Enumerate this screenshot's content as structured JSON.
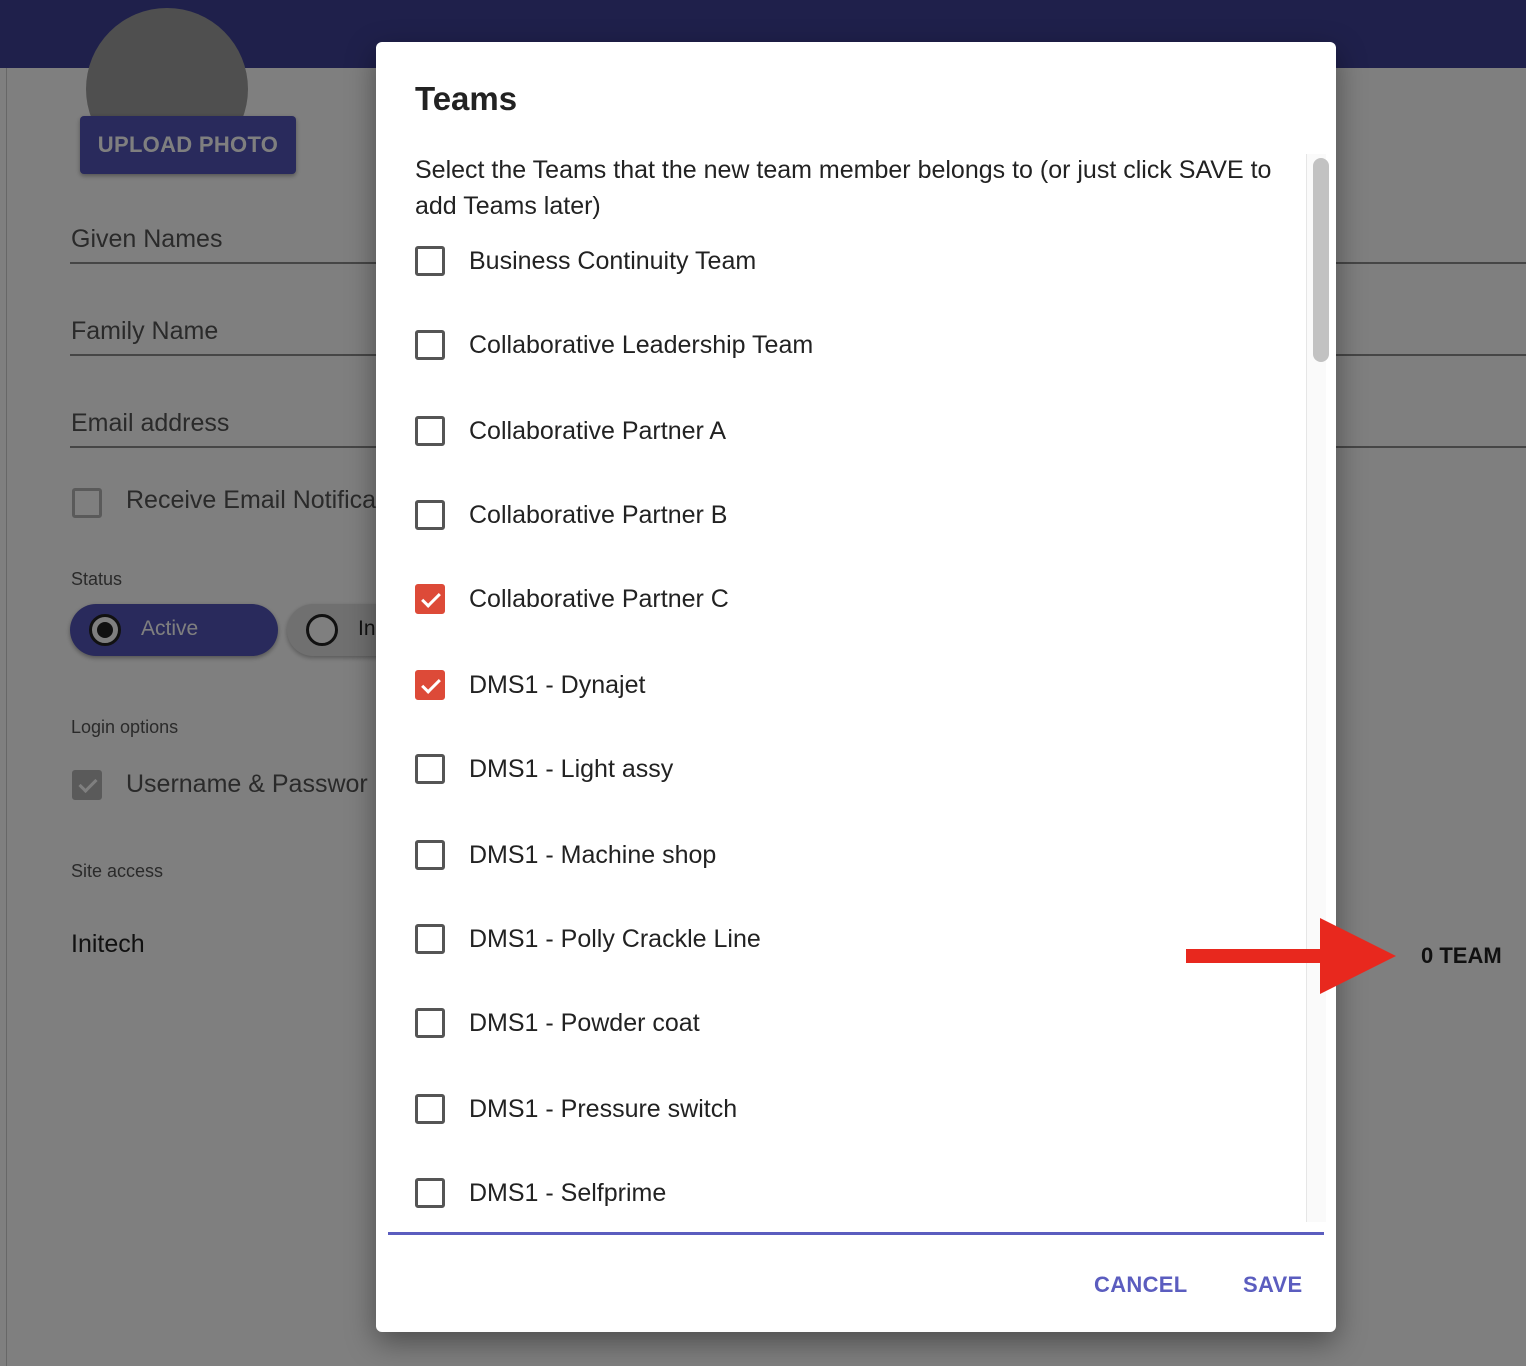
{
  "form": {
    "upload_photo_label": "UPLOAD PHOTO",
    "given_names_label": "Given Names",
    "family_name_label": "Family Name",
    "email_label": "Email address",
    "receive_email_label": "Receive Email Notifica",
    "status_caption": "Status",
    "status_active_label": "Active",
    "status_inactive_label": "In",
    "login_options_caption": "Login options",
    "username_password_label": "Username & Passwor",
    "site_access_caption": "Site access",
    "site_name": "Initech",
    "team_count": "0 TEAM"
  },
  "dialog": {
    "title": "Teams",
    "instructions": "Select the Teams that the new team member belongs to (or just click SAVE to add Teams later)",
    "teams": [
      {
        "label": "Business Continuity Team",
        "checked": false
      },
      {
        "label": "Collaborative Leadership Team",
        "checked": false
      },
      {
        "label": "Collaborative Partner A",
        "checked": false
      },
      {
        "label": "Collaborative Partner B",
        "checked": false
      },
      {
        "label": "Collaborative Partner C",
        "checked": true
      },
      {
        "label": "DMS1 - Dynajet",
        "checked": true
      },
      {
        "label": "DMS1 - Light assy",
        "checked": false
      },
      {
        "label": "DMS1 - Machine shop",
        "checked": false
      },
      {
        "label": "DMS1 - Polly Crackle Line",
        "checked": false
      },
      {
        "label": "DMS1 - Powder coat",
        "checked": false
      },
      {
        "label": "DMS1 - Pressure switch",
        "checked": false
      },
      {
        "label": "DMS1 - Selfprime",
        "checked": false
      }
    ],
    "cancel_label": "CANCEL",
    "save_label": "SAVE"
  },
  "colors": {
    "appbar": "#3f4196",
    "accent": "#5b5dbf",
    "checkbox_checked": "#dd4a38",
    "annotation_arrow": "#e8281e"
  }
}
